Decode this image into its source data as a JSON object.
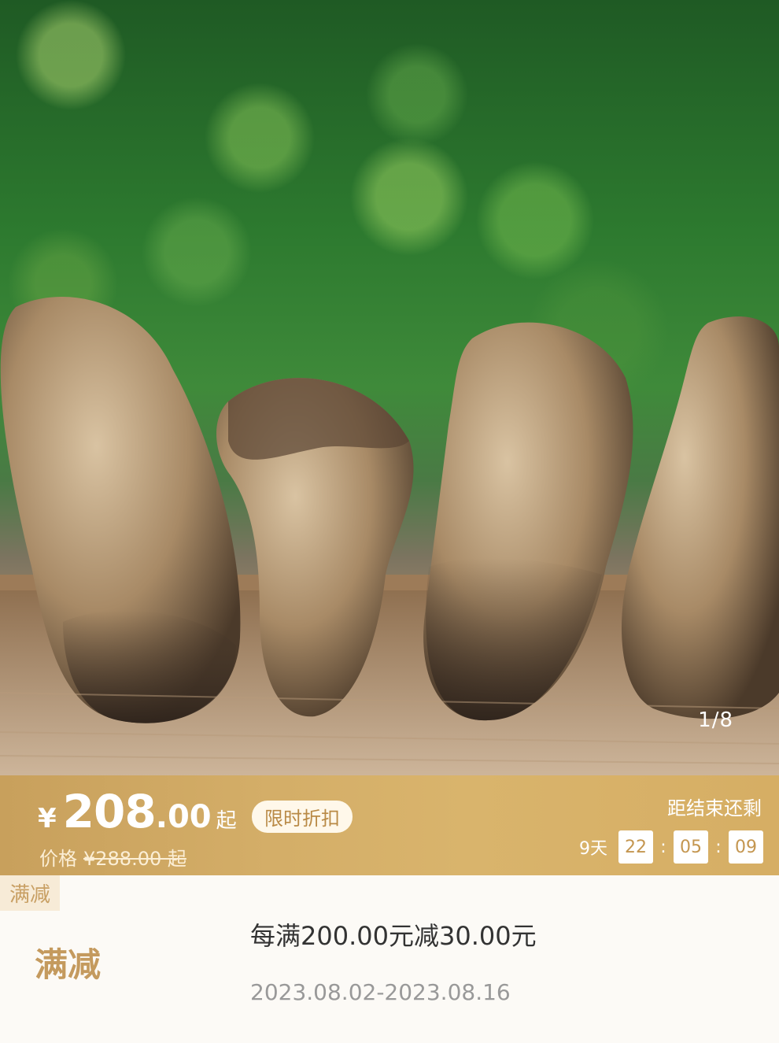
{
  "product": {
    "image_counter": "1/8",
    "price": {
      "currency": "¥",
      "integer": "208",
      "decimal": ".00",
      "suffix": "起",
      "tag": "限时折扣",
      "original_label": "价格",
      "original_value": "¥288.00 起"
    },
    "countdown": {
      "label": "距结束还剩",
      "days": "9天",
      "hours": "22",
      "minutes": "05",
      "seconds": "09",
      "sep": ":"
    }
  },
  "promo": {
    "label": "满减",
    "title": "满减",
    "description": "每满200.00元减30.00元",
    "date_range": "2023.08.02-2023.08.16"
  },
  "colors": {
    "band": "#d4ae68",
    "accent": "#c49a5e"
  }
}
